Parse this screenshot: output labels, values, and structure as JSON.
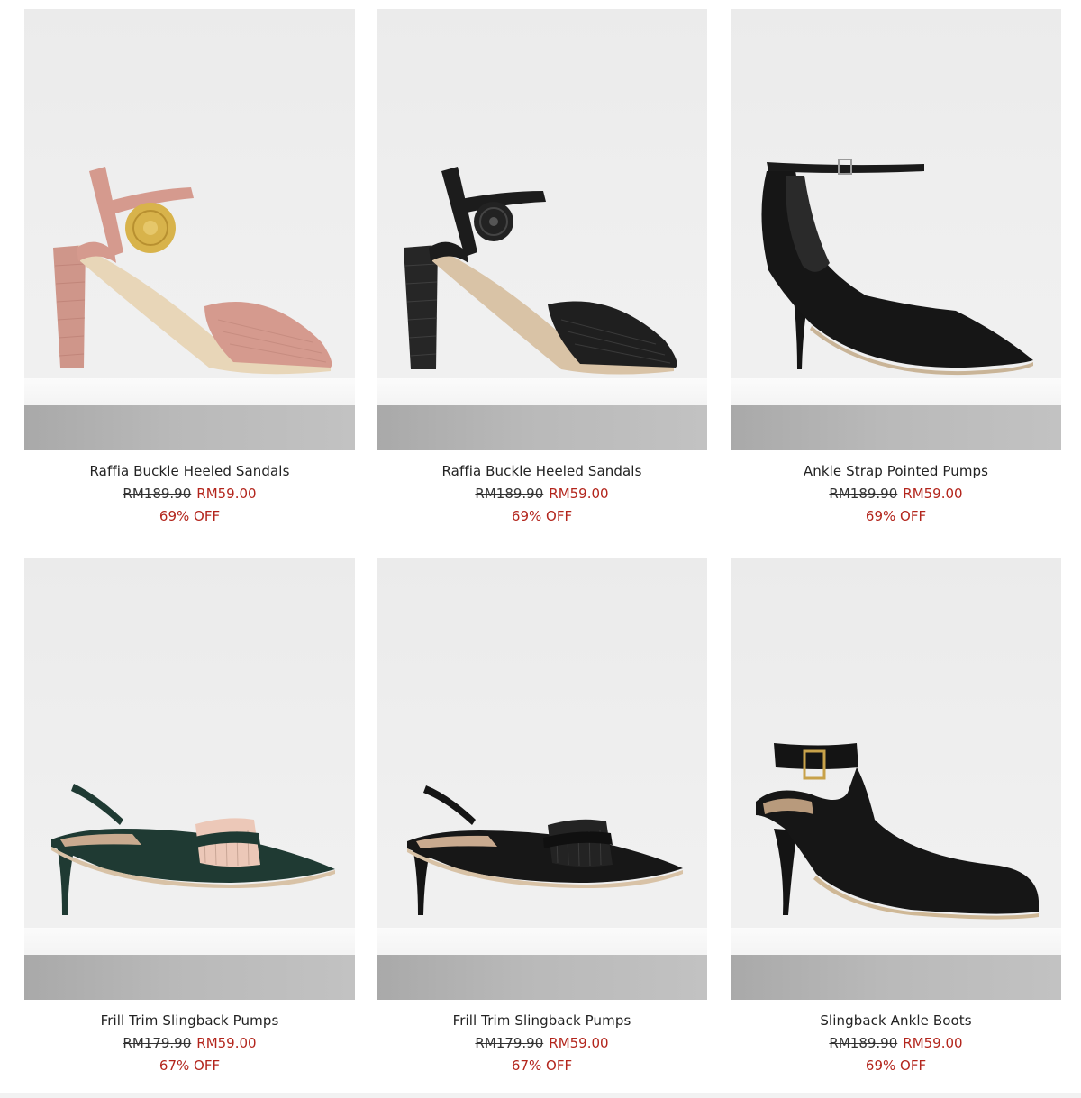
{
  "products": [
    {
      "name": "Raffia Buckle Heeled Sandals",
      "old_price": "RM189.90",
      "new_price": "RM59.00",
      "discount": "69% OFF",
      "image": "pink-raffia-buckle-sandal",
      "colors": {
        "main": "#d59a8e",
        "accent": "#d9b54a"
      }
    },
    {
      "name": "Raffia Buckle Heeled Sandals",
      "old_price": "RM189.90",
      "new_price": "RM59.00",
      "discount": "69% OFF",
      "image": "black-raffia-buckle-sandal",
      "colors": {
        "main": "#1c1c1c",
        "accent": "#2a2a2a"
      }
    },
    {
      "name": "Ankle Strap Pointed Pumps",
      "old_price": "RM189.90",
      "new_price": "RM59.00",
      "discount": "69% OFF",
      "image": "black-ankle-strap-pump",
      "colors": {
        "main": "#161616",
        "accent": "#8a8a8a"
      }
    },
    {
      "name": "Frill Trim Slingback Pumps",
      "old_price": "RM179.90",
      "new_price": "RM59.00",
      "discount": "67% OFF",
      "image": "green-frill-slingback-pump",
      "colors": {
        "main": "#1f3a33",
        "accent": "#e8c3b4"
      }
    },
    {
      "name": "Frill Trim Slingback Pumps",
      "old_price": "RM179.90",
      "new_price": "RM59.00",
      "discount": "67% OFF",
      "image": "black-frill-slingback-pump",
      "colors": {
        "main": "#151515",
        "accent": "#2b2b2b"
      }
    },
    {
      "name": "Slingback Ankle Boots",
      "old_price": "RM189.90",
      "new_price": "RM59.00",
      "discount": "69% OFF",
      "image": "black-slingback-ankle-boot",
      "colors": {
        "main": "#141414",
        "accent": "#c8a24a"
      }
    }
  ],
  "theme": {
    "sale_color": "#b3251c",
    "text_color": "#222222"
  }
}
